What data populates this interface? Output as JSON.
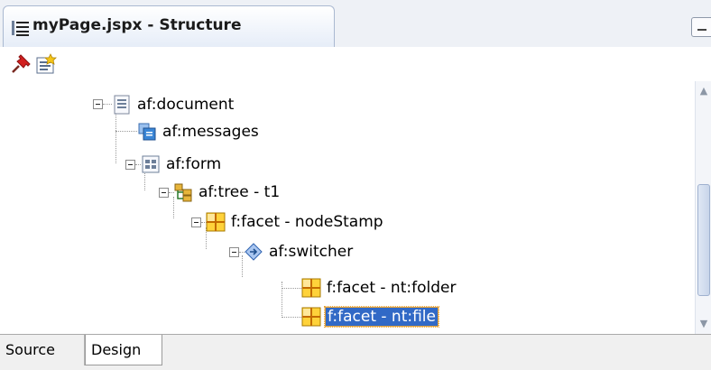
{
  "window": {
    "tab_title": "myPage.jspx - Structure",
    "tab_icon": "structure-list-icon",
    "minimize_icon": "minimize-icon"
  },
  "toolbar": {
    "pin_icon": "pushpin-icon",
    "new_view_icon": "new-view-icon"
  },
  "tree": {
    "nodes": [
      {
        "label": "af:document",
        "icon": "document-icon"
      },
      {
        "label": "af:messages",
        "icon": "messages-icon"
      },
      {
        "label": "af:form",
        "icon": "form-icon"
      },
      {
        "label": "af:tree - t1",
        "icon": "tree-icon"
      },
      {
        "label": "f:facet - nodeStamp",
        "icon": "facet-icon"
      },
      {
        "label": "af:switcher",
        "icon": "switcher-icon"
      },
      {
        "label": "f:facet - nt:folder",
        "icon": "facet-icon"
      },
      {
        "label": "f:facet - nt:file",
        "icon": "facet-icon",
        "selected": true
      }
    ]
  },
  "bottom_tabs": {
    "source": "Source",
    "design": "Design",
    "active": "Design"
  },
  "colors": {
    "selection": "#3169c6",
    "selection_border": "#e0a13d"
  }
}
